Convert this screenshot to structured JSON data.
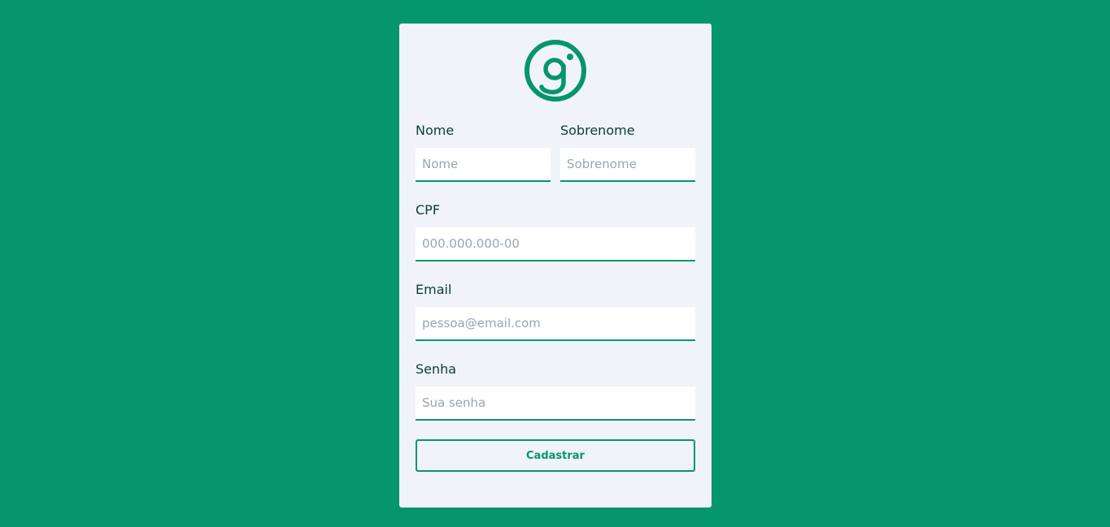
{
  "brand": {
    "logo_icon": "g-logo-icon",
    "color": "#059669"
  },
  "form": {
    "first_name": {
      "label": "Nome",
      "placeholder": "Nome",
      "value": ""
    },
    "last_name": {
      "label": "Sobrenome",
      "placeholder": "Sobrenome",
      "value": ""
    },
    "cpf": {
      "label": "CPF",
      "placeholder": "000.000.000-00",
      "value": ""
    },
    "email": {
      "label": "Email",
      "placeholder": "pessoa@email.com",
      "value": ""
    },
    "password": {
      "label": "Senha",
      "placeholder": "Sua senha",
      "value": ""
    },
    "submit_label": "Cadastrar"
  },
  "colors": {
    "background": "#059669",
    "card": "#f0f4f8",
    "label_text": "#0b3d33",
    "placeholder": "#9aa5b1"
  }
}
